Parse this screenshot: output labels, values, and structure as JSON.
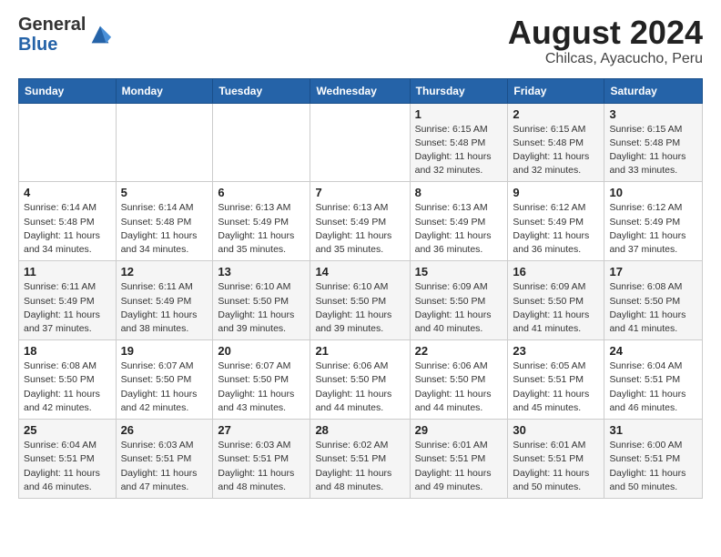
{
  "header": {
    "logo_line1": "General",
    "logo_line2": "Blue",
    "title": "August 2024",
    "subtitle": "Chilcas, Ayacucho, Peru"
  },
  "calendar": {
    "days_of_week": [
      "Sunday",
      "Monday",
      "Tuesday",
      "Wednesday",
      "Thursday",
      "Friday",
      "Saturday"
    ],
    "weeks": [
      [
        {
          "day": "",
          "info": ""
        },
        {
          "day": "",
          "info": ""
        },
        {
          "day": "",
          "info": ""
        },
        {
          "day": "",
          "info": ""
        },
        {
          "day": "1",
          "sunrise": "6:15 AM",
          "sunset": "5:48 PM",
          "daylight": "11 hours and 32 minutes."
        },
        {
          "day": "2",
          "sunrise": "6:15 AM",
          "sunset": "5:48 PM",
          "daylight": "11 hours and 32 minutes."
        },
        {
          "day": "3",
          "sunrise": "6:15 AM",
          "sunset": "5:48 PM",
          "daylight": "11 hours and 33 minutes."
        }
      ],
      [
        {
          "day": "4",
          "sunrise": "6:14 AM",
          "sunset": "5:48 PM",
          "daylight": "11 hours and 34 minutes."
        },
        {
          "day": "5",
          "sunrise": "6:14 AM",
          "sunset": "5:48 PM",
          "daylight": "11 hours and 34 minutes."
        },
        {
          "day": "6",
          "sunrise": "6:13 AM",
          "sunset": "5:49 PM",
          "daylight": "11 hours and 35 minutes."
        },
        {
          "day": "7",
          "sunrise": "6:13 AM",
          "sunset": "5:49 PM",
          "daylight": "11 hours and 35 minutes."
        },
        {
          "day": "8",
          "sunrise": "6:13 AM",
          "sunset": "5:49 PM",
          "daylight": "11 hours and 36 minutes."
        },
        {
          "day": "9",
          "sunrise": "6:12 AM",
          "sunset": "5:49 PM",
          "daylight": "11 hours and 36 minutes."
        },
        {
          "day": "10",
          "sunrise": "6:12 AM",
          "sunset": "5:49 PM",
          "daylight": "11 hours and 37 minutes."
        }
      ],
      [
        {
          "day": "11",
          "sunrise": "6:11 AM",
          "sunset": "5:49 PM",
          "daylight": "11 hours and 37 minutes."
        },
        {
          "day": "12",
          "sunrise": "6:11 AM",
          "sunset": "5:49 PM",
          "daylight": "11 hours and 38 minutes."
        },
        {
          "day": "13",
          "sunrise": "6:10 AM",
          "sunset": "5:50 PM",
          "daylight": "11 hours and 39 minutes."
        },
        {
          "day": "14",
          "sunrise": "6:10 AM",
          "sunset": "5:50 PM",
          "daylight": "11 hours and 39 minutes."
        },
        {
          "day": "15",
          "sunrise": "6:09 AM",
          "sunset": "5:50 PM",
          "daylight": "11 hours and 40 minutes."
        },
        {
          "day": "16",
          "sunrise": "6:09 AM",
          "sunset": "5:50 PM",
          "daylight": "11 hours and 41 minutes."
        },
        {
          "day": "17",
          "sunrise": "6:08 AM",
          "sunset": "5:50 PM",
          "daylight": "11 hours and 41 minutes."
        }
      ],
      [
        {
          "day": "18",
          "sunrise": "6:08 AM",
          "sunset": "5:50 PM",
          "daylight": "11 hours and 42 minutes."
        },
        {
          "day": "19",
          "sunrise": "6:07 AM",
          "sunset": "5:50 PM",
          "daylight": "11 hours and 42 minutes."
        },
        {
          "day": "20",
          "sunrise": "6:07 AM",
          "sunset": "5:50 PM",
          "daylight": "11 hours and 43 minutes."
        },
        {
          "day": "21",
          "sunrise": "6:06 AM",
          "sunset": "5:50 PM",
          "daylight": "11 hours and 44 minutes."
        },
        {
          "day": "22",
          "sunrise": "6:06 AM",
          "sunset": "5:50 PM",
          "daylight": "11 hours and 44 minutes."
        },
        {
          "day": "23",
          "sunrise": "6:05 AM",
          "sunset": "5:51 PM",
          "daylight": "11 hours and 45 minutes."
        },
        {
          "day": "24",
          "sunrise": "6:04 AM",
          "sunset": "5:51 PM",
          "daylight": "11 hours and 46 minutes."
        }
      ],
      [
        {
          "day": "25",
          "sunrise": "6:04 AM",
          "sunset": "5:51 PM",
          "daylight": "11 hours and 46 minutes."
        },
        {
          "day": "26",
          "sunrise": "6:03 AM",
          "sunset": "5:51 PM",
          "daylight": "11 hours and 47 minutes."
        },
        {
          "day": "27",
          "sunrise": "6:03 AM",
          "sunset": "5:51 PM",
          "daylight": "11 hours and 48 minutes."
        },
        {
          "day": "28",
          "sunrise": "6:02 AM",
          "sunset": "5:51 PM",
          "daylight": "11 hours and 48 minutes."
        },
        {
          "day": "29",
          "sunrise": "6:01 AM",
          "sunset": "5:51 PM",
          "daylight": "11 hours and 49 minutes."
        },
        {
          "day": "30",
          "sunrise": "6:01 AM",
          "sunset": "5:51 PM",
          "daylight": "11 hours and 50 minutes."
        },
        {
          "day": "31",
          "sunrise": "6:00 AM",
          "sunset": "5:51 PM",
          "daylight": "11 hours and 50 minutes."
        }
      ]
    ]
  }
}
